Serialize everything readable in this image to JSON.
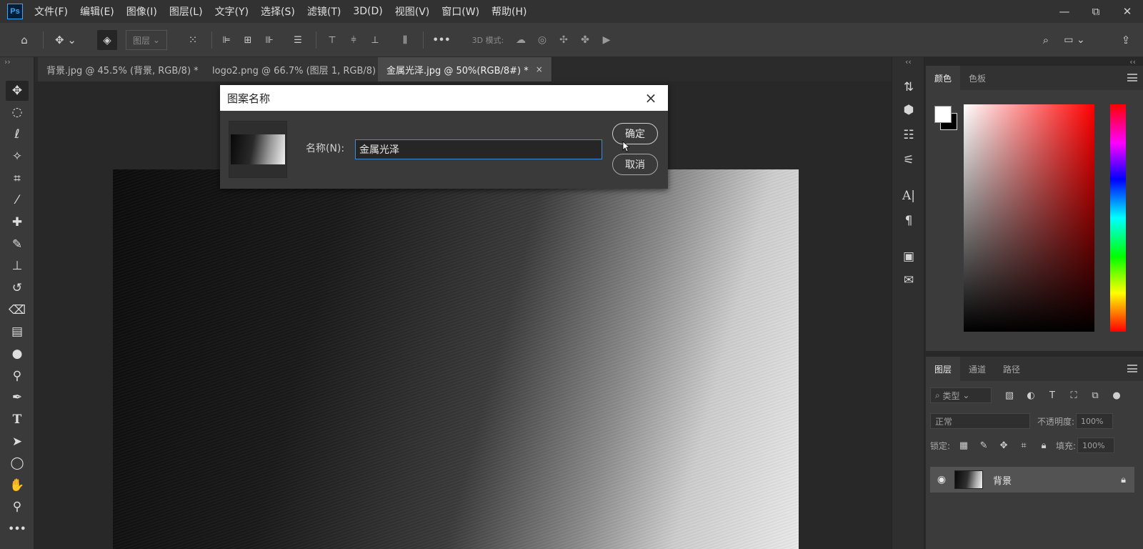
{
  "menubar": {
    "logo": "Ps",
    "items": [
      "文件(F)",
      "编辑(E)",
      "图像(I)",
      "图层(L)",
      "文字(Y)",
      "选择(S)",
      "滤镜(T)",
      "3D(D)",
      "视图(V)",
      "窗口(W)",
      "帮助(H)"
    ],
    "window_controls": {
      "minimize": "—",
      "restore": "⧉",
      "close": "✕"
    }
  },
  "options": {
    "layer_select": "图层",
    "mode_label": "3D 模式:",
    "more": "•••"
  },
  "tabs": [
    {
      "label": "背景.jpg @ 45.5% (背景, RGB/8) *",
      "close": "×"
    },
    {
      "label": "logo2.png @ 66.7% (图层 1, RGB/8)",
      "close": "×"
    },
    {
      "label": "金属光泽.jpg @ 50%(RGB/8#) *",
      "close": "×"
    }
  ],
  "dialog": {
    "title": "图案名称",
    "close": "×",
    "name_label": "名称(N):",
    "name_value": "金属光泽",
    "ok_label": "确定",
    "cancel_label": "取消"
  },
  "color_panel": {
    "tabs": [
      "颜色",
      "色板"
    ],
    "foreground": "#ffffff",
    "background": "#000000"
  },
  "layers_panel": {
    "tabs": [
      "图层",
      "通道",
      "路径"
    ],
    "filter_label": "类型",
    "blend_mode": "正常",
    "opacity_label": "不透明度:",
    "opacity_value": "100%",
    "lock_label": "锁定:",
    "fill_label": "填充:",
    "fill_value": "100%",
    "layers": [
      {
        "name": "背景",
        "visible": true,
        "locked": true
      }
    ]
  },
  "collapse_markers": {
    "left": "››",
    "right": "‹‹"
  }
}
